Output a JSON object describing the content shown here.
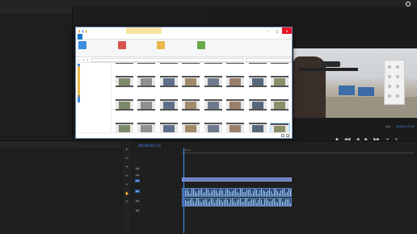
{
  "premiere": {
    "menu": [
      "",
      "",
      "",
      "",
      "",
      "",
      ""
    ],
    "watermark": {
      "line1": "",
      "line2": ""
    },
    "left_panel_tabs": [
      "",
      "",
      "",
      ""
    ],
    "program_monitor": {
      "title": "",
      "timecode": "00:00:17:05",
      "ratio": "1/4"
    },
    "effects_tabs": [
      "",
      "",
      ""
    ],
    "effects_items": [
      "",
      "",
      "",
      "",
      "",
      "",
      "",
      ""
    ],
    "timeline": {
      "timecode": "00:00:01:15",
      "ruler": [
        "00:00",
        "",
        "",
        "",
        "",
        "",
        ""
      ]
    },
    "track_tags": {
      "v": [
        "V3",
        "V2",
        "V1"
      ],
      "a": [
        "A1",
        "A2",
        "A3"
      ]
    },
    "transport": [
      "◆",
      "◀◀",
      "◀",
      "▶",
      "▶▶",
      "⇥",
      "+"
    ],
    "tools": [
      "▸",
      "⇔",
      "✦",
      "↔",
      "✎",
      "✋",
      "T"
    ]
  },
  "explorer": {
    "context_tab": "",
    "title": "",
    "win_buttons": {
      "min": "–",
      "max": "□",
      "close": "✕"
    },
    "tabs": {
      "file": "",
      "home": "",
      "share": "",
      "view": "",
      "manage": ""
    },
    "ribbon": {
      "group1": [
        "",
        "",
        ""
      ],
      "group1_caption": "",
      "group2": [
        "",
        "",
        ""
      ],
      "group2_caption": "",
      "group3": [
        "",
        "",
        "",
        ""
      ],
      "group3_caption": "",
      "group4": [
        "",
        "",
        ""
      ],
      "group4_caption": ""
    },
    "address": {
      "back": "←",
      "forward": "→",
      "up": "↑",
      "path": "",
      "search_placeholder": ""
    },
    "navpane": [
      {
        "label": "",
        "icon": "star"
      },
      {
        "label": "",
        "icon": "folder"
      },
      {
        "label": "",
        "icon": "folder"
      },
      {
        "label": "",
        "icon": "folder"
      },
      {
        "label": "",
        "icon": "folder"
      },
      {
        "label": "",
        "icon": "folder"
      },
      {
        "label": "",
        "icon": "folder"
      },
      {
        "label": "",
        "icon": "folder"
      },
      {
        "label": "",
        "icon": "folder"
      },
      {
        "label": "",
        "icon": "folder"
      },
      {
        "label": "",
        "icon": "folder"
      },
      {
        "label": "",
        "icon": "folder"
      },
      {
        "label": "",
        "icon": "folder"
      },
      {
        "label": "",
        "icon": "drive"
      },
      {
        "label": "",
        "icon": "cloud"
      },
      {
        "label": "",
        "icon": "pc"
      }
    ],
    "files": [
      {
        "name": ""
      },
      {
        "name": ""
      },
      {
        "name": ""
      },
      {
        "name": ""
      },
      {
        "name": ""
      },
      {
        "name": ""
      },
      {
        "name": ""
      },
      {
        "name": ""
      },
      {
        "name": ""
      },
      {
        "name": ""
      },
      {
        "name": ""
      },
      {
        "name": ""
      },
      {
        "name": ""
      },
      {
        "name": ""
      },
      {
        "name": ""
      },
      {
        "name": ""
      },
      {
        "name": ""
      },
      {
        "name": ""
      },
      {
        "name": ""
      },
      {
        "name": ""
      },
      {
        "name": ""
      },
      {
        "name": ""
      },
      {
        "name": ""
      },
      {
        "name": ""
      },
      {
        "name": ""
      },
      {
        "name": ""
      },
      {
        "name": ""
      },
      {
        "name": ""
      },
      {
        "name": ""
      },
      {
        "name": ""
      },
      {
        "name": ""
      },
      {
        "name": ""
      }
    ],
    "tooltip": "",
    "status": {
      "count": "",
      "selected": ""
    }
  }
}
